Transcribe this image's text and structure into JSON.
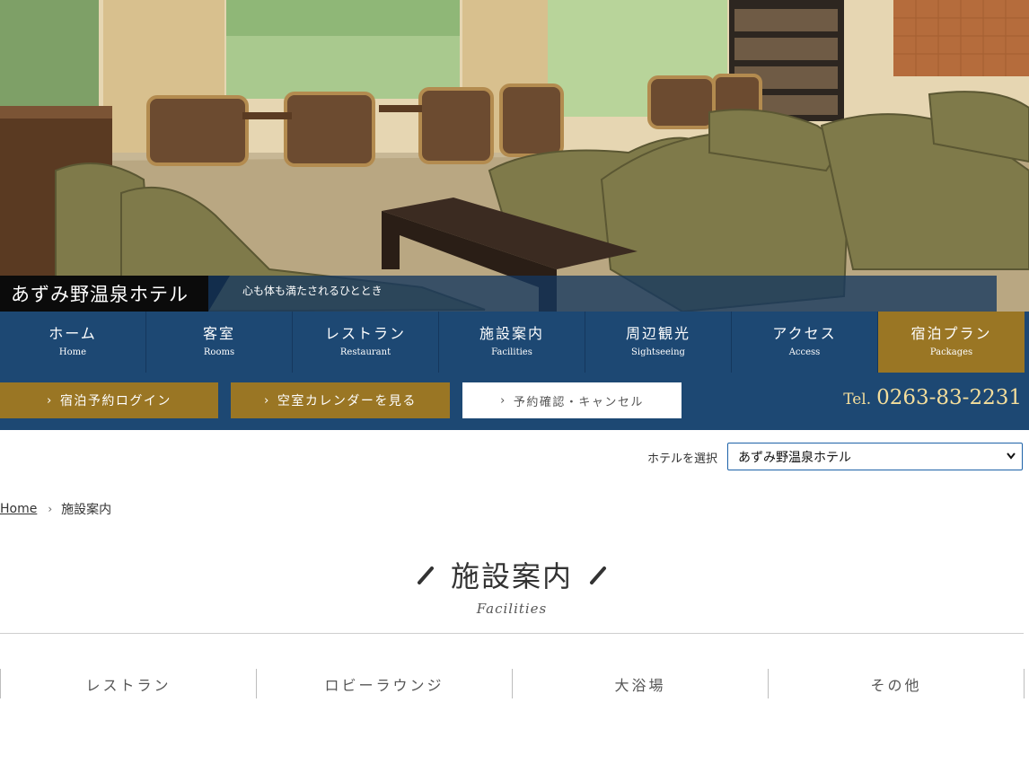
{
  "hero": {
    "hotel_name": "あずみ野温泉ホテル",
    "tagline": "心も体も満たされるひととき"
  },
  "nav": {
    "items": [
      {
        "jp": "ホーム",
        "en": "Home"
      },
      {
        "jp": "客室",
        "en": "Rooms"
      },
      {
        "jp": "レストラン",
        "en": "Restaurant"
      },
      {
        "jp": "施設案内",
        "en": "Facilities"
      },
      {
        "jp": "周辺観光",
        "en": "Sightseeing"
      },
      {
        "jp": "アクセス",
        "en": "Access"
      },
      {
        "jp": "宿泊プラン",
        "en": "Packages"
      }
    ],
    "active_index": 6
  },
  "actions": {
    "login": "宿泊予約ログイン",
    "calendar": "空室カレンダーを見る",
    "confirm": "予約確認・キャンセル",
    "tel_label": "Tel.",
    "tel_number": "0263-83-2231"
  },
  "hotel_select": {
    "label": "ホテルを選択",
    "selected": "あずみ野温泉ホテル"
  },
  "breadcrumb": {
    "home": "Home",
    "current": "施設案内"
  },
  "page": {
    "title": "施設案内",
    "subtitle": "Facilities"
  },
  "tabs": [
    "レストラン",
    "ロビーラウンジ",
    "大浴場",
    "その他"
  ],
  "colors": {
    "navy": "#1d4873",
    "gold": "#9a7624",
    "tel_gold": "#f4de9c"
  },
  "icons": {
    "chevron": "chevron-right-icon",
    "select_caret": "chevron-down-icon",
    "slash": "slash-decoration-icon"
  }
}
